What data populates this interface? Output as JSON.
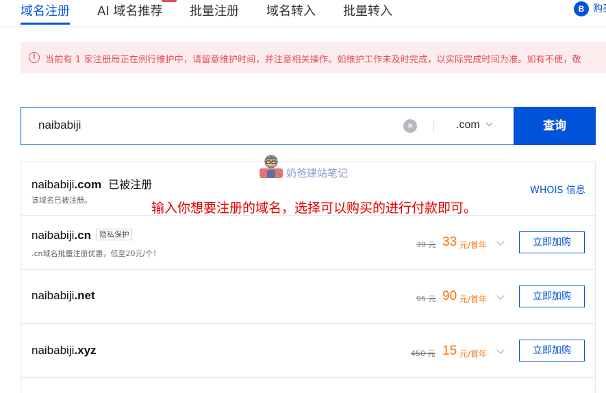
{
  "tabs": [
    {
      "label": "域名注册",
      "active": true
    },
    {
      "label": "AI 域名推荐",
      "active": false
    },
    {
      "label": "批量注册",
      "active": false
    },
    {
      "label": "域名转入",
      "active": false
    },
    {
      "label": "批量转入",
      "active": false
    }
  ],
  "help": {
    "icon_letter": "B",
    "label": "购买"
  },
  "alert": {
    "icon": "!",
    "text": "当前有 1 家注册局正在例行维护中，请留意维护时间，并注意相关操作。如维护工作未及时完成，以实际完成时间为准。如有不便，敬"
  },
  "search": {
    "value": "naibabiji",
    "suffix": ".com",
    "button_label": "查询",
    "clear_icon": "×"
  },
  "results": [
    {
      "name": "naibabiji",
      "tld": ".com",
      "status": "已被注册",
      "note": "该域名已被注册。",
      "whois_label": "WHOIS 信息"
    },
    {
      "name": "naibabiji",
      "tld": ".cn",
      "tag": "隐私保护",
      "note": ".cn域名批量注册优惠，低至20元/个！",
      "old_price": "39 元",
      "price": "33",
      "unit": "元/首年",
      "buy_label": "立即加购"
    },
    {
      "name": "naibabiji",
      "tld": ".net",
      "old_price": "95 元",
      "price": "90",
      "unit": "元/首年",
      "buy_label": "立即加购"
    },
    {
      "name": "naibabiji",
      "tld": ".xyz",
      "old_price": "450 元",
      "price": "15",
      "unit": "元/首年",
      "buy_label": "立即加购"
    }
  ],
  "watermark": {
    "text": "奶爸建站笔记"
  },
  "annotation": {
    "text": "输入你想要注册的域名，选择可以购买的进行付款即可。"
  },
  "colors": {
    "primary": "#0052d9",
    "price": "#ff7000",
    "alert_text": "#e34d59",
    "alert_bg": "#fdecee",
    "annotation": "#e60000"
  }
}
